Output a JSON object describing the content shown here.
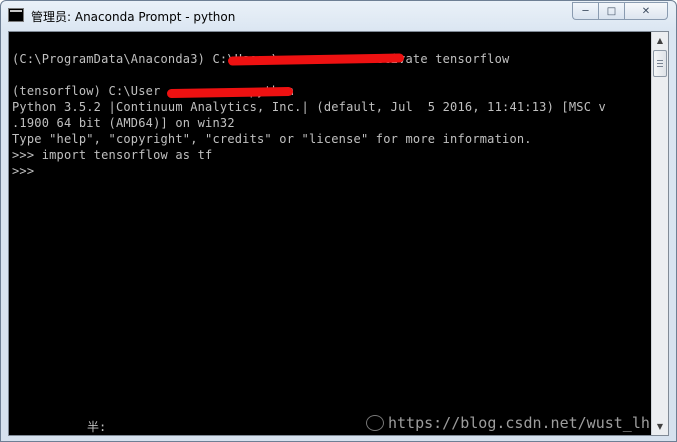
{
  "window": {
    "title": "管理员: Anaconda Prompt - python",
    "icon": "console-app-icon"
  },
  "caption_buttons": {
    "minimize": "─",
    "maximize": "□",
    "close": "✕"
  },
  "console": {
    "lines": [
      "(C:\\ProgramData\\Anaconda3) C:\\Users\\            activate tensorflow",
      "",
      "(tensorflow) C:\\User            python",
      "Python 3.5.2 |Continuum Analytics, Inc.| (default, Jul  5 2016, 11:41:13) [MSC v",
      ".1900 64 bit (AMD64)] on win32",
      "Type \"help\", \"copyright\", \"credits\" or \"license\" for more information.",
      ">>> import tensorflow as tf",
      ">>>"
    ],
    "ime_status": "半:",
    "redaction_color": "#ee1111"
  },
  "scrollbar": {
    "up": "▲",
    "down": "▼"
  },
  "watermark": {
    "text": "https://blog.csdn.net/wust_lh"
  }
}
